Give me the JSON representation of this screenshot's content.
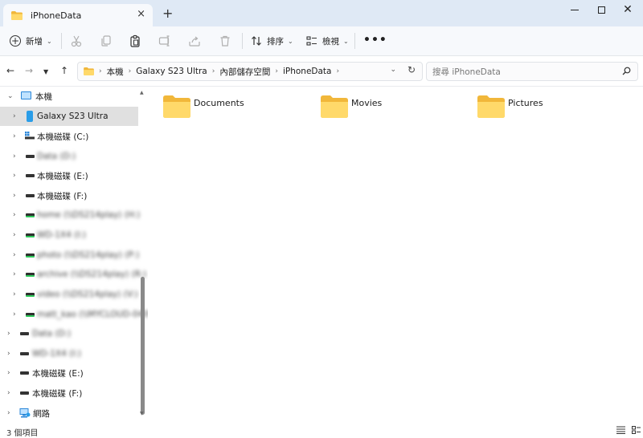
{
  "window": {
    "tab_title": "iPhoneData",
    "tab_close": "×",
    "new_tab": "+"
  },
  "toolbar": {
    "new_label": "新增",
    "sort_label": "排序",
    "view_label": "檢視",
    "more_label": "•••"
  },
  "address": {
    "crumbs": [
      "本機",
      "Galaxy S23 Ultra",
      "內部儲存空間",
      "iPhoneData"
    ],
    "separator": "›"
  },
  "search": {
    "placeholder": "搜尋 iPhoneData"
  },
  "sidebar": {
    "items": [
      {
        "label": "本機",
        "expanded": true,
        "icon": "pc-icon"
      },
      {
        "label": "Galaxy S23 Ultra",
        "selected": true,
        "icon": "phone-icon"
      },
      {
        "label": "本機磁碟 (C:)",
        "icon": "windows-drive-icon"
      },
      {
        "label": "Data (D:)",
        "icon": "drive-icon",
        "blurred": true
      },
      {
        "label": "本機磁碟 (E:)",
        "icon": "drive-icon"
      },
      {
        "label": "本機磁碟 (F:)",
        "icon": "drive-icon"
      },
      {
        "label": "home (\\\\DS214play) (H:)",
        "icon": "network-drive-icon",
        "blurred": true
      },
      {
        "label": "WD-1X4 (I:)",
        "icon": "network-drive-icon",
        "blurred": true
      },
      {
        "label": "photo (\\\\DS214play) (P:)",
        "icon": "network-drive-icon",
        "blurred": true
      },
      {
        "label": "archive (\\\\DS214play) (R:)",
        "icon": "network-drive-icon",
        "blurred": true
      },
      {
        "label": "video (\\\\DS214play) (V:)",
        "icon": "network-drive-icon",
        "blurred": true
      },
      {
        "label": "matt_kao (\\\\MYCLOUD-0409",
        "icon": "network-drive-icon",
        "blurred": true
      },
      {
        "label": "Data (D:)",
        "icon": "drive-icon",
        "blurred": true
      },
      {
        "label": "WD-1X4 (I:)",
        "icon": "drive-icon",
        "blurred": true
      },
      {
        "label": "本機磁碟 (E:)",
        "icon": "drive-icon"
      },
      {
        "label": "本機磁碟 (F:)",
        "icon": "drive-icon"
      },
      {
        "label": "網路",
        "icon": "network-icon"
      }
    ]
  },
  "files": [
    {
      "name": "Documents",
      "icon": "folder-icon"
    },
    {
      "name": "Movies",
      "icon": "folder-icon"
    },
    {
      "name": "Pictures",
      "icon": "folder-icon"
    }
  ],
  "status": {
    "item_count": "3 個項目"
  },
  "colors": {
    "titlebar": "#dfe9f5",
    "folder_front": "#ffd96a",
    "folder_back": "#f1b73a",
    "selected_row": "#e0e0e0",
    "accent_blue": "#2a86d8"
  }
}
